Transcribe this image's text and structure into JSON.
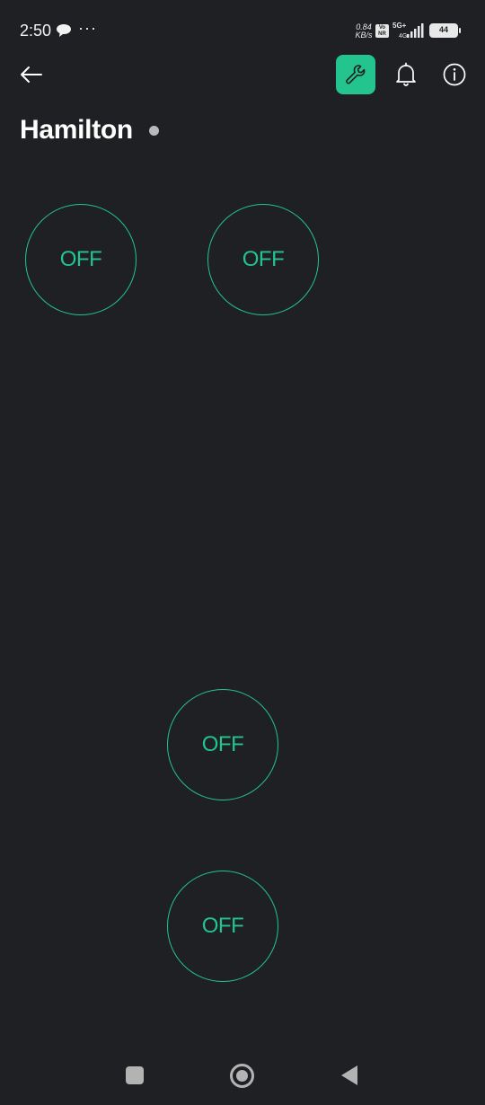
{
  "status_bar": {
    "time": "2:50",
    "more": "···",
    "net_speed_value": "0.84",
    "net_speed_unit": "KB/s",
    "volte": "Vo NR",
    "net_type": "5G+",
    "net_sub": "4G",
    "battery_level": "44",
    "battery_fraction": 0.44
  },
  "toolbar": {
    "back_icon": "arrow-left-icon",
    "settings_icon": "wrench-icon",
    "notifications_icon": "bell-icon",
    "info_icon": "info-icon",
    "accent_color": "#23c48e"
  },
  "device": {
    "name": "Hamilton",
    "status_color": "#b8b9bb"
  },
  "switches": [
    {
      "label": "OFF"
    },
    {
      "label": "OFF"
    },
    {
      "label": "OFF"
    },
    {
      "label": "OFF"
    }
  ],
  "nav_bar": {
    "recent_icon": "square-icon",
    "home_icon": "circle-icon",
    "back_icon": "triangle-back-icon"
  }
}
